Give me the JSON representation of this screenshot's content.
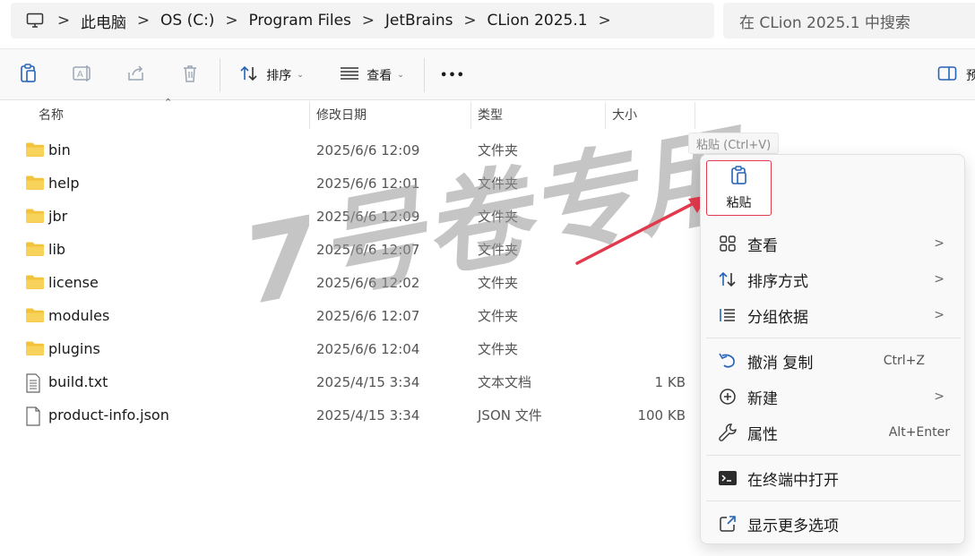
{
  "address": {
    "segments": [
      "此电脑",
      "OS (C:)",
      "Program Files",
      "JetBrains",
      "CLion 2025.1"
    ],
    "separator": ">",
    "search_placeholder": "在 CLion 2025.1 中搜索"
  },
  "toolbar": {
    "sort_label": "排序",
    "view_label": "查看",
    "more_label": "•••",
    "preview_label": "预"
  },
  "columns": {
    "name": "名称",
    "date": "修改日期",
    "type": "类型",
    "size": "大小"
  },
  "files": [
    {
      "name": "bin",
      "date": "2025/6/6 12:09",
      "type": "文件夹",
      "size": "",
      "icon": "folder-icon"
    },
    {
      "name": "help",
      "date": "2025/6/6 12:01",
      "type": "文件夹",
      "size": "",
      "icon": "folder-icon"
    },
    {
      "name": "jbr",
      "date": "2025/6/6 12:09",
      "type": "文件夹",
      "size": "",
      "icon": "folder-icon"
    },
    {
      "name": "lib",
      "date": "2025/6/6 12:07",
      "type": "文件夹",
      "size": "",
      "icon": "folder-icon"
    },
    {
      "name": "license",
      "date": "2025/6/6 12:02",
      "type": "文件夹",
      "size": "",
      "icon": "folder-icon"
    },
    {
      "name": "modules",
      "date": "2025/6/6 12:07",
      "type": "文件夹",
      "size": "",
      "icon": "folder-icon"
    },
    {
      "name": "plugins",
      "date": "2025/6/6 12:04",
      "type": "文件夹",
      "size": "",
      "icon": "folder-icon"
    },
    {
      "name": "build.txt",
      "date": "2025/4/15 3:34",
      "type": "文本文档",
      "size": "1 KB",
      "icon": "text-file-icon"
    },
    {
      "name": "product-info.json",
      "date": "2025/4/15 3:34",
      "type": "JSON 文件",
      "size": "100 KB",
      "icon": "file-icon"
    }
  ],
  "tooltip": "粘贴 (Ctrl+V)",
  "context_menu": {
    "paste_label": "粘贴",
    "items": [
      {
        "label": "查看",
        "shortcut": "",
        "submenu": true
      },
      {
        "label": "排序方式",
        "shortcut": "",
        "submenu": true
      },
      {
        "label": "分组依据",
        "shortcut": "",
        "submenu": true
      },
      {
        "label": "撤消 复制",
        "shortcut": "Ctrl+Z",
        "submenu": false
      },
      {
        "label": "新建",
        "shortcut": "",
        "submenu": true
      },
      {
        "label": "属性",
        "shortcut": "Alt+Enter",
        "submenu": false
      },
      {
        "label": "在终端中打开",
        "shortcut": "",
        "submenu": false
      },
      {
        "label": "显示更多选项",
        "shortcut": "",
        "submenu": false
      }
    ],
    "submenu_arrow": ">"
  },
  "watermark": "7号卷专用",
  "colors": {
    "folder": "#f4c33c",
    "highlight_border": "#e23a4d",
    "arrow": "#e23a4d",
    "accent_blue": "#2563b6"
  }
}
